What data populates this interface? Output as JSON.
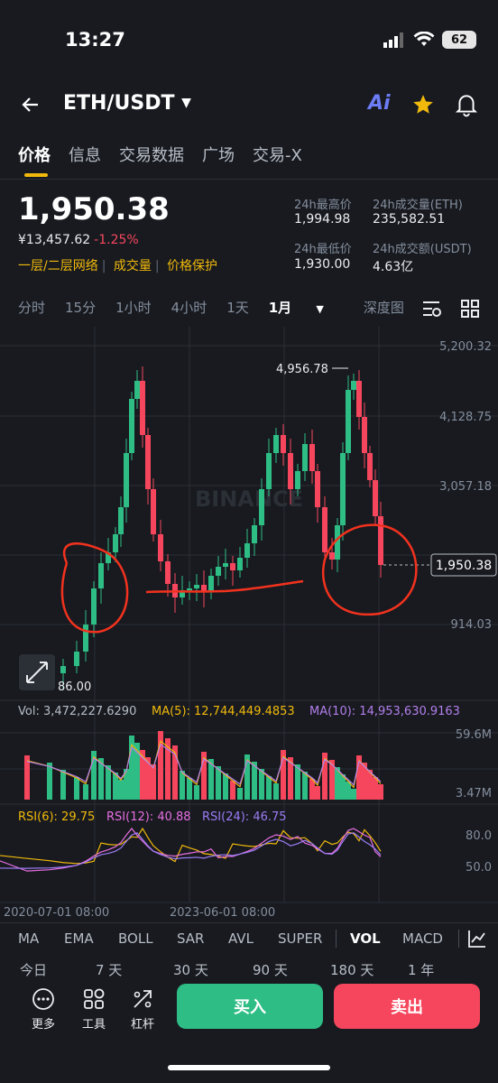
{
  "status": {
    "time": "13:27",
    "battery": "62"
  },
  "header": {
    "pair": "ETH/USDT",
    "ai_label": "Ai"
  },
  "tabs": [
    "价格",
    "信息",
    "交易数据",
    "广场",
    "交易-X"
  ],
  "ticker": {
    "price": "1,950.38",
    "cny": "¥13,457.62",
    "change": "-1.25%",
    "tags": [
      "一层/二层网络",
      "成交量",
      "价格保护"
    ],
    "high_label": "24h最高价",
    "high": "1,994.98",
    "vol_eth_label": "24h成交量(ETH)",
    "vol_eth": "235,582.51",
    "low_label": "24h最低价",
    "low": "1,930.00",
    "vol_usdt_label": "24h成交额(USDT)",
    "vol_usdt": "4.63亿"
  },
  "intervals": [
    "分时",
    "15分",
    "1小时",
    "4小时",
    "1天",
    "1月",
    "深度图"
  ],
  "chart": {
    "price_ticks": [
      "5,200.32",
      "4,128.75",
      "3,057.18",
      "914.03"
    ],
    "current_price": "1,950.38",
    "max_label": "4,956.78",
    "min_label": "86.00",
    "vol_line": "Vol: 3,472,227.6290",
    "ma5_line": "MA(5): 12,744,449.4853",
    "ma10_line": "MA(10): 14,953,630.9163",
    "vol_ticks": [
      "59.6M",
      "3.47M"
    ],
    "rsi6": "RSI(6): 29.75",
    "rsi12": "RSI(12): 40.88",
    "rsi24": "RSI(24): 46.75",
    "rsi_ticks": [
      "80.0",
      "50.0"
    ],
    "dates": [
      "2020-07-01 08:00",
      "2023-06-01 08:00"
    ],
    "watermark": "BINANCE",
    "colors": {
      "up": "#2ebd85",
      "down": "#f6465d",
      "ma5": "#f0b90b",
      "ma10": "#b37feb",
      "rsi24": "#9c7cf4",
      "annotation": "#f2321e"
    }
  },
  "indicator_tabs": [
    "MA",
    "EMA",
    "BOLL",
    "SAR",
    "AVL",
    "SUPER",
    "VOL",
    "MACD"
  ],
  "range_tabs": [
    "今日",
    "7 天",
    "30 天",
    "90 天",
    "180 天",
    "1 年"
  ],
  "tools": [
    "更多",
    "工具",
    "杠杆"
  ],
  "buy_label": "买入",
  "sell_label": "卖出"
}
